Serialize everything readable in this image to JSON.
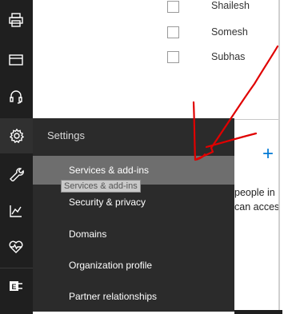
{
  "users": [
    {
      "name": "Shailesh"
    },
    {
      "name": "Somesh"
    },
    {
      "name": "Subhas"
    }
  ],
  "settings": {
    "title": "Settings",
    "items": [
      {
        "label": "Services & add-ins"
      },
      {
        "label": "Security & privacy"
      },
      {
        "label": "Domains"
      },
      {
        "label": "Organization profile"
      },
      {
        "label": "Partner relationships"
      }
    ],
    "tooltip": "Services & add-ins"
  },
  "background": {
    "line1": "people in",
    "line2": "can acces"
  },
  "colors": {
    "rail": "#1f1f1f",
    "panel": "#2b2b2b",
    "selected": "#6e6e6e",
    "accent": "#0078d4",
    "ink": "#e00000"
  },
  "rail_icons": [
    "printer-icon",
    "billing-card-icon",
    "headset-icon",
    "gear-icon",
    "wrench-icon",
    "chart-icon",
    "health-heart-icon",
    "exchange-icon"
  ]
}
